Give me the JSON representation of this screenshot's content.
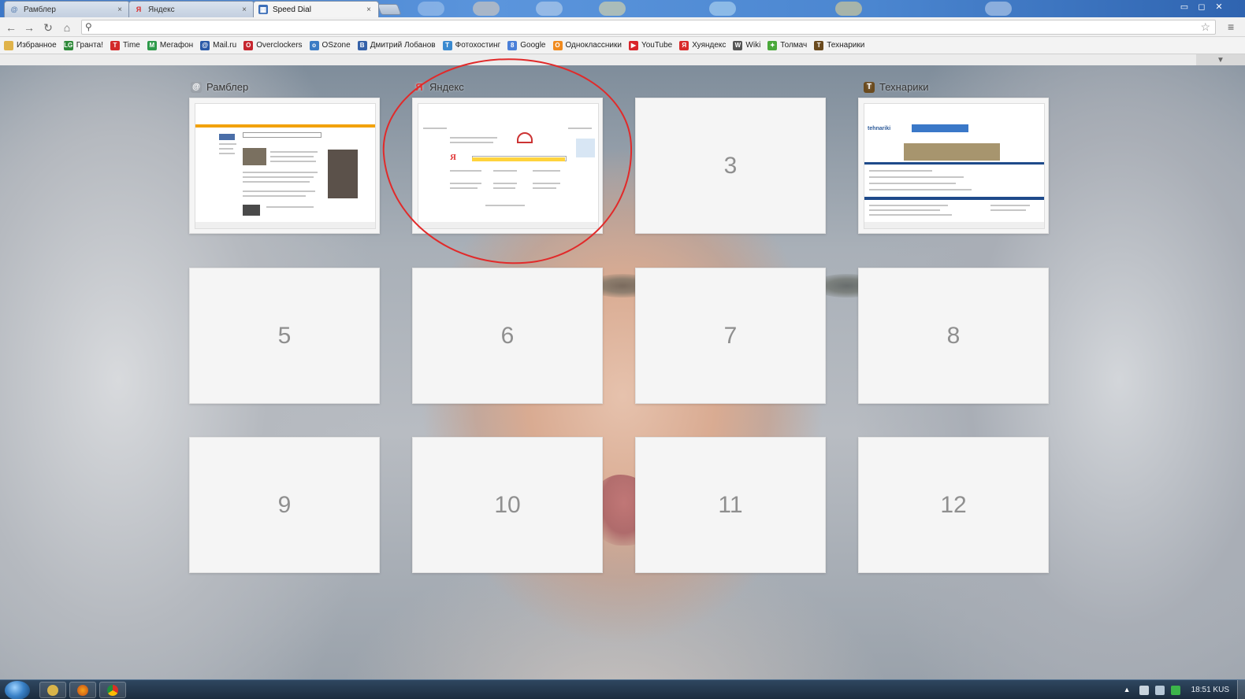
{
  "browser": {
    "tabs": [
      {
        "label": "Рамблер",
        "icon": "rambler-icon",
        "close": "×"
      },
      {
        "label": "Яндекс",
        "icon": "yandex-icon",
        "close": "×"
      },
      {
        "label": "Speed Dial",
        "icon": "speed-dial-icon",
        "close": "×"
      }
    ],
    "window_controls": {
      "minimize": "▭",
      "maximize": "◻",
      "close": "✕"
    },
    "omnibox": {
      "value": "",
      "placeholder": ""
    },
    "icons": {
      "back": "←",
      "forward": "→",
      "reload": "↻",
      "home": "⌂",
      "search": "⚲",
      "star": "☆",
      "menu": "≡"
    }
  },
  "bookmarks": [
    {
      "label": "Избранное",
      "icon": "folder-icon",
      "color": "#e0b34a"
    },
    {
      "label": "Гранта!",
      "icon": "lg-icon",
      "color": "#2f8a3a",
      "glyph": "LG"
    },
    {
      "label": "Time",
      "icon": "time-icon",
      "color": "#d32a2a",
      "glyph": "T"
    },
    {
      "label": "Мегафон",
      "icon": "megafon-icon",
      "color": "#2e9a4a",
      "glyph": "M"
    },
    {
      "label": "Mail.ru",
      "icon": "mailru-icon",
      "color": "#2a5aa8",
      "glyph": "@"
    },
    {
      "label": "Overclockers",
      "icon": "overclockers-icon",
      "color": "#c6262e",
      "glyph": "O"
    },
    {
      "label": "OSzone",
      "icon": "oszone-icon",
      "color": "#3b7bc4",
      "glyph": "o"
    },
    {
      "label": "Дмитрий Лобанов",
      "icon": "blog-icon",
      "color": "#3561a8",
      "glyph": "B"
    },
    {
      "label": "Фотохостинг",
      "icon": "photohost-icon",
      "color": "#3a8ad0",
      "glyph": "T"
    },
    {
      "label": "Google",
      "icon": "google-icon",
      "color": "#4a7fd8",
      "glyph": "8"
    },
    {
      "label": "Одноклассники",
      "icon": "odnoklassniki-icon",
      "color": "#f08a1e",
      "glyph": "O"
    },
    {
      "label": "YouTube",
      "icon": "youtube-icon",
      "color": "#d9242a",
      "glyph": "▶"
    },
    {
      "label": "Хуяндекс",
      "icon": "yandex-icon",
      "color": "#d92a2a",
      "glyph": "Я"
    },
    {
      "label": "Wiki",
      "icon": "wiki-icon",
      "color": "#555555",
      "glyph": "W"
    },
    {
      "label": "Толмач",
      "icon": "tolmach-icon",
      "color": "#4aa83a",
      "glyph": "✦"
    },
    {
      "label": "Технарики",
      "icon": "tehnariki-icon",
      "color": "#6a4a1e",
      "glyph": "T"
    }
  ],
  "page": {
    "options_icon": "▼"
  },
  "speed_dial": {
    "labels": [
      {
        "text": "Рамблер",
        "icon": "rambler-icon",
        "color": "#9aa0a8"
      },
      {
        "text": "Яндекс",
        "icon": "yandex-icon",
        "color": "#e23a3a"
      },
      {
        "text": "Технарики",
        "icon": "tehnariki-icon",
        "color": "#6a4a1e"
      }
    ],
    "tiles": [
      {
        "num": "",
        "site": "Рамблер"
      },
      {
        "num": "",
        "site": "Яндекс"
      },
      {
        "num": "3"
      },
      {
        "num": "",
        "site": "Технарики"
      },
      {
        "num": "5"
      },
      {
        "num": "6"
      },
      {
        "num": "7"
      },
      {
        "num": "8"
      },
      {
        "num": "9"
      },
      {
        "num": "10"
      },
      {
        "num": "11"
      },
      {
        "num": "12"
      }
    ],
    "annotation_color": "#e12a2a"
  },
  "taskbar": {
    "clock": "18:51 KUS"
  }
}
